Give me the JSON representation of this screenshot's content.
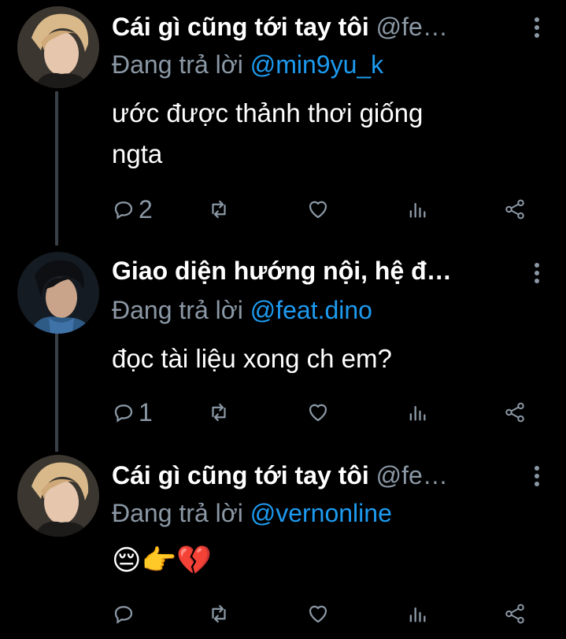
{
  "tweets": [
    {
      "name": "Cái gì cũng tới tay tôi",
      "handle": "@fe…",
      "reply_prefix": "Đang trả lời",
      "reply_mention": "@min9yu_k",
      "text_lines": [
        "ước được thảnh thơi giống",
        "ngta"
      ],
      "reply_count": "2",
      "avatar": "avatar-blond"
    },
    {
      "name": "Giao diện hướng nội, hệ đ…",
      "handle": "",
      "reply_prefix": "Đang trả lời",
      "reply_mention": "@feat.dino",
      "text_lines": [
        "đọc tài liệu xong ch em?"
      ],
      "reply_count": "1",
      "avatar": "avatar-dark"
    },
    {
      "name": "Cái gì cũng tới tay tôi",
      "handle": "@fe…",
      "reply_prefix": "Đang trả lời",
      "reply_mention": "@vernonline",
      "text_lines": [
        "😔👉💔"
      ],
      "reply_count": "",
      "avatar": "avatar-blond"
    }
  ],
  "colors": {
    "background": "#000000",
    "mention": "#1d9bf0",
    "muted": "#8b98a5",
    "thread_line": "#3a4048"
  },
  "icons": [
    "reply-icon",
    "retweet-icon",
    "like-icon",
    "views-icon",
    "share-icon",
    "more-icon"
  ]
}
